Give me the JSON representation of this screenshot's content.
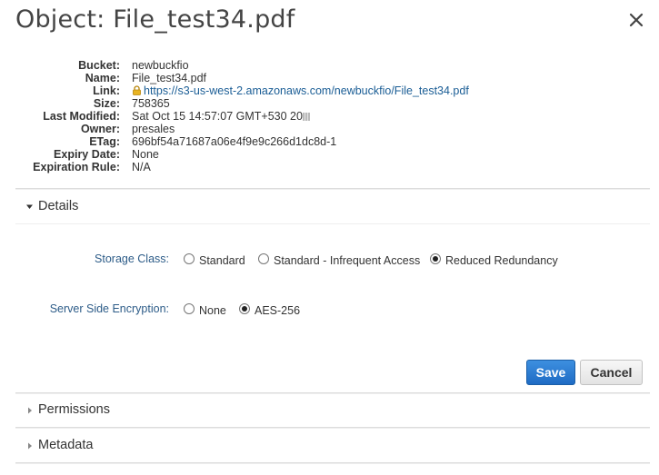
{
  "dialog": {
    "title": "Object: File_test34.pdf"
  },
  "properties": [
    {
      "label": "Bucket:",
      "value": "newbuckfio"
    },
    {
      "label": "Name:",
      "value": "File_test34.pdf"
    },
    {
      "label": "Link:",
      "value": "https://s3-us-west-2.amazonaws.com/newbuckfio/File_test34.pdf",
      "icon": "lock-icon"
    },
    {
      "label": "Size:",
      "value": "758365"
    },
    {
      "label": "Last Modified:",
      "value": "Sat Oct 15 14:57:07 GMT+530 20"
    },
    {
      "label": "Owner:",
      "value": "presales"
    },
    {
      "label": "ETag:",
      "value": "696bf54a71687a06e4f9e9c266d1dc8d-1"
    },
    {
      "label": "Expiry Date:",
      "value": "None"
    },
    {
      "label": "Expiration Rule:",
      "value": "N/A"
    }
  ],
  "sections": {
    "details": {
      "label": "Details",
      "expanded": true
    },
    "permissions": {
      "label": "Permissions",
      "expanded": false
    },
    "metadata": {
      "label": "Metadata",
      "expanded": false
    }
  },
  "storage_class": {
    "label": "Storage Class:",
    "options": [
      "Standard",
      "Standard - Infrequent Access",
      "Reduced Redundancy"
    ],
    "selected": "Reduced Redundancy"
  },
  "encryption": {
    "label": "Server Side Encryption:",
    "options": [
      "None",
      "AES-256"
    ],
    "selected": "AES-256"
  },
  "buttons": {
    "save": "Save",
    "cancel": "Cancel"
  },
  "colors": {
    "link": "#1a5d95",
    "field_label": "#2d5c88",
    "save_bg": "#2a7ad2"
  }
}
